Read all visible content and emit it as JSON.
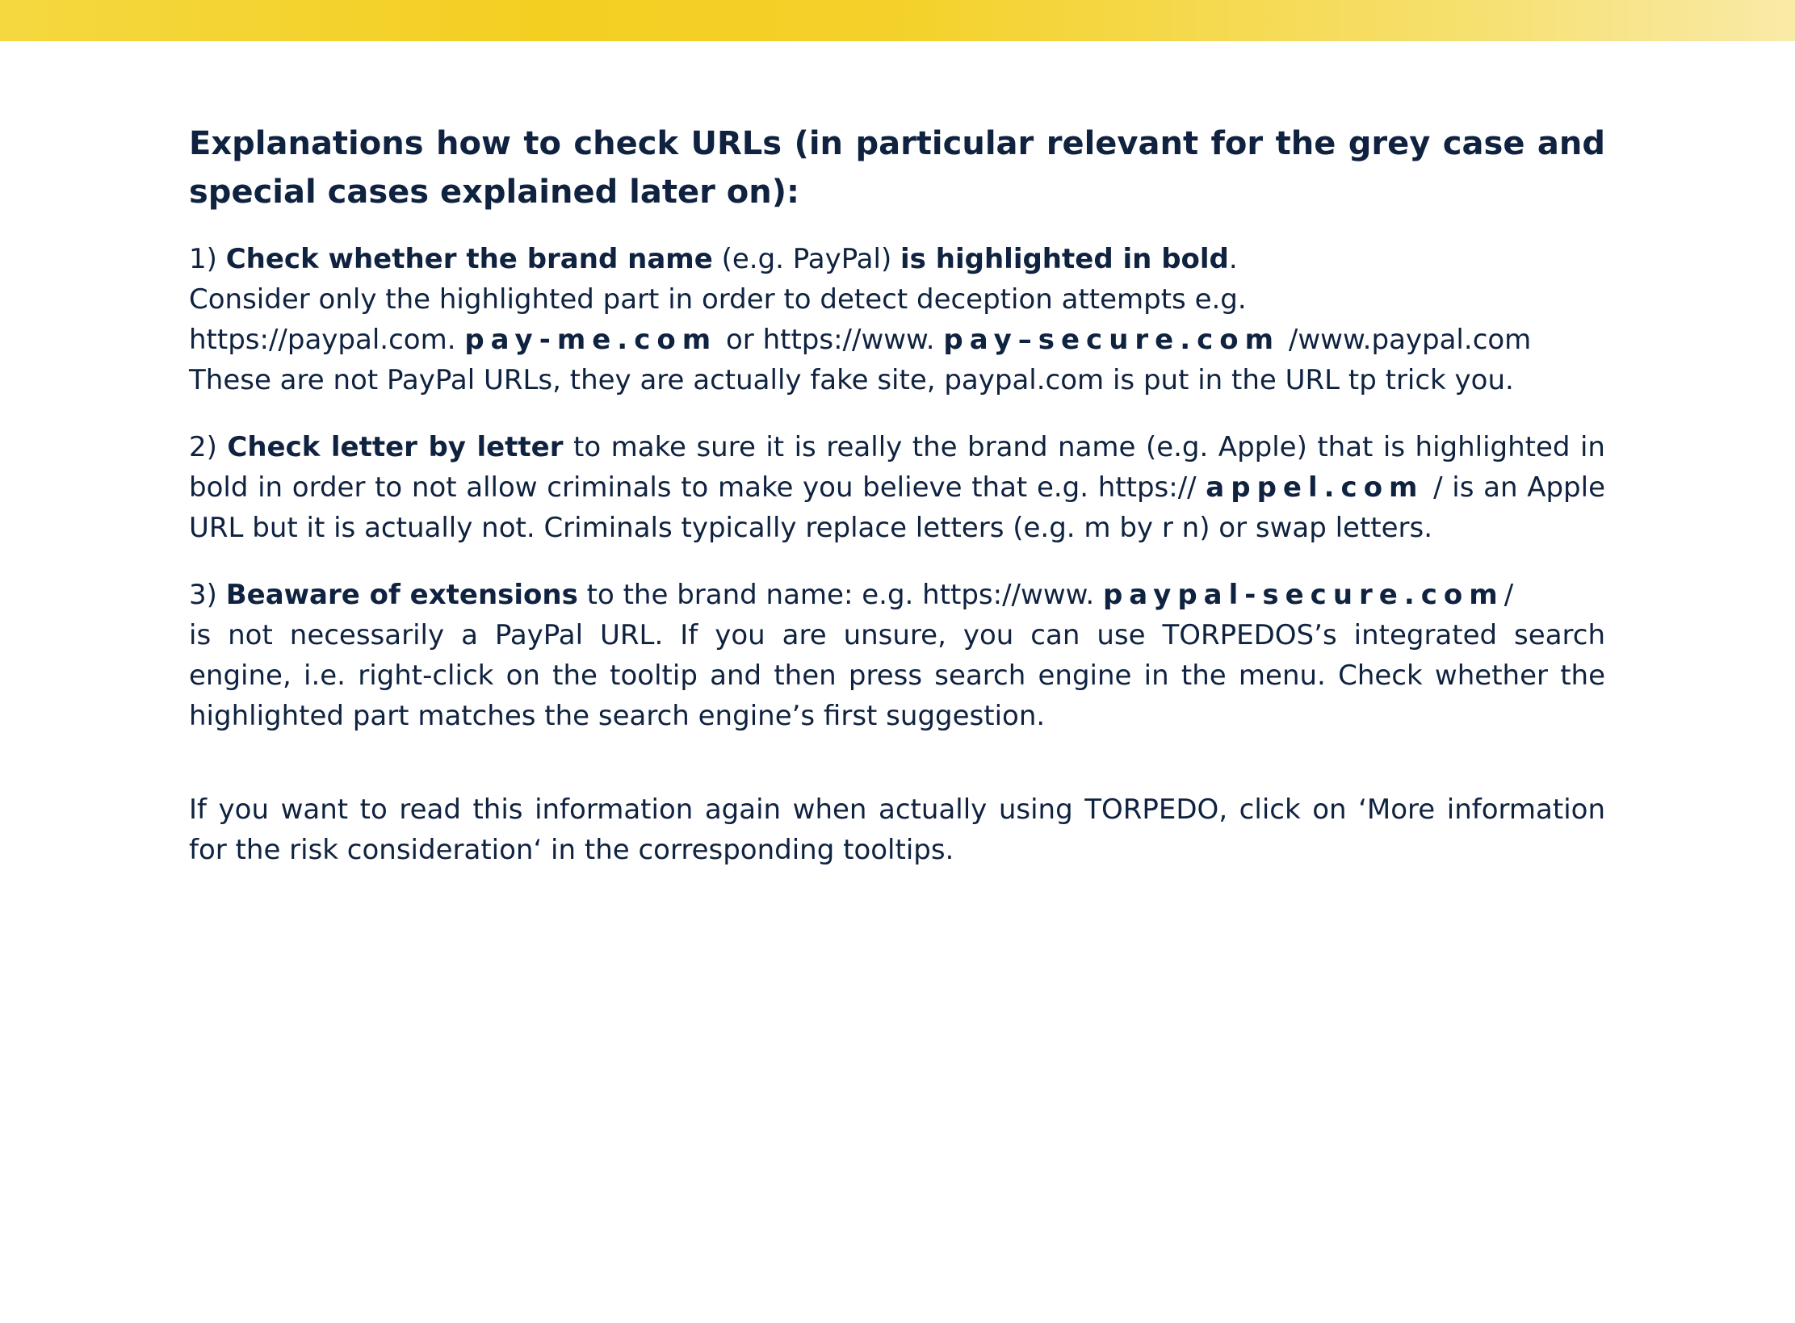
{
  "colors": {
    "accent_bar": "#f3cf22",
    "text": "#0f2240"
  },
  "heading": "Explanations how to check URLs (in particular relevant for the grey case and special cases explained later on):",
  "p1": {
    "num": "1) ",
    "b1": "Check whether the brand name",
    "t1": " (e.g. PayPal) ",
    "b2": "is highlighted in bold",
    "t2": ".",
    "line2": "Consider only the highlighted part in order to detect deception attempts e.g.",
    "url1_pre": "https://paypal.com. ",
    "url1_bold": "pay-me.com",
    "url1_mid": " or https://www. ",
    "url2_bold": "pay–secure.com",
    "url2_post": " /www.paypal.com",
    "line4": "These are not PayPal URLs, they are actually fake site, paypal.com is put in the URL tp trick you."
  },
  "p2": {
    "num": "2) ",
    "bold": "Check letter by letter",
    "t1": " to make sure it is really the brand name (e.g. Apple) that is highlighted in",
    "t2": "bold in order to not allow criminals to make you believe that e.g. https:// ",
    "url_bold": "appel.com",
    "t3": " / is an Apple",
    "t4": "URL but it is actually not. Criminals typically replace letters (e.g. m by r n) or swap letters."
  },
  "p3": {
    "num": "3) ",
    "bold": "Beaware of extensions",
    "t1": " to the brand name: e.g. https://www. ",
    "url_bold": "paypal-secure.com",
    "t2": "/",
    "t3": "is not necessarily a PayPal URL. If you are unsure, you can use TORPEDOS’s integrated search",
    "t4": "engine, i.e. right-click on the tooltip and then press search engine in the menu. Check whether the",
    "t5": "highlighted part matches the search engine’s first suggestion."
  },
  "footer": "If you want to read this information again when actually using TORPEDO, click on ‘More information for the risk consideration‘ in the corresponding tooltips."
}
